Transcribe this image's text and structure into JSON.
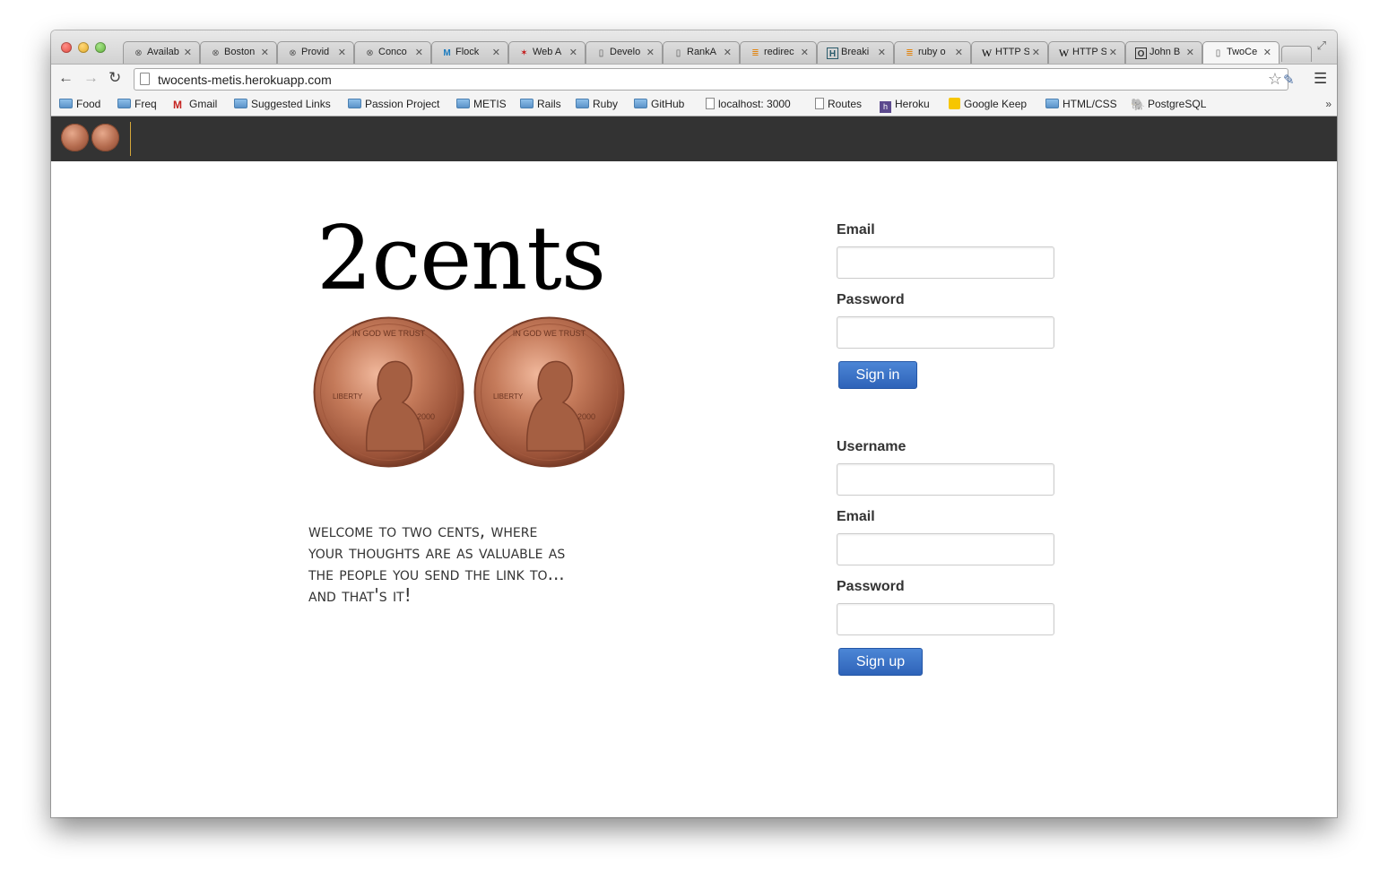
{
  "browser": {
    "tabs": [
      {
        "label": "Availab",
        "icon": "metis-icon"
      },
      {
        "label": "Boston",
        "icon": "metis-icon"
      },
      {
        "label": "Provid",
        "icon": "metis-icon"
      },
      {
        "label": "Conco",
        "icon": "metis-icon"
      },
      {
        "label": "Flock",
        "icon": "flock-icon"
      },
      {
        "label": "Web A",
        "icon": "mozilla-icon"
      },
      {
        "label": "Develo",
        "icon": "page-icon"
      },
      {
        "label": "RankA",
        "icon": "page-icon"
      },
      {
        "label": "redirec",
        "icon": "stackoverflow-icon"
      },
      {
        "label": "Breaki",
        "icon": "h-icon"
      },
      {
        "label": "ruby o",
        "icon": "stackoverflow-icon"
      },
      {
        "label": "HTTP S",
        "icon": "wikipedia-icon"
      },
      {
        "label": "HTTP S",
        "icon": "wikipedia-icon"
      },
      {
        "label": "John B",
        "icon": "o-icon"
      },
      {
        "label": "TwoCe",
        "icon": "page-icon"
      }
    ],
    "url": "twocents-metis.herokuapp.com",
    "bookmarks": [
      {
        "label": "Food",
        "icon": "folder-icon"
      },
      {
        "label": "Freq",
        "icon": "folder-icon"
      },
      {
        "label": "Gmail",
        "icon": "gmail-icon"
      },
      {
        "label": "Suggested Links",
        "icon": "folder-icon"
      },
      {
        "label": "Passion Project",
        "icon": "folder-icon"
      },
      {
        "label": "METIS",
        "icon": "folder-icon"
      },
      {
        "label": "Rails",
        "icon": "folder-icon"
      },
      {
        "label": "Ruby",
        "icon": "folder-icon"
      },
      {
        "label": "GitHub",
        "icon": "folder-icon"
      },
      {
        "label": "localhost: 3000",
        "icon": "page-icon"
      },
      {
        "label": "Routes",
        "icon": "page-icon"
      },
      {
        "label": "Heroku",
        "icon": "heroku-icon"
      },
      {
        "label": "Google Keep",
        "icon": "keep-icon"
      },
      {
        "label": "HTML/CSS",
        "icon": "folder-icon"
      },
      {
        "label": "PostgreSQL",
        "icon": "postgresql-icon"
      }
    ],
    "bookmarks_more": "»"
  },
  "hero": {
    "logo_text": "2cents",
    "welcome": "Welcome to two cents, where your thoughts are as valuable as the people you send the link to... and that's it!",
    "coin_year": "2000",
    "coin_motto": "IN GOD WE TRUST",
    "coin_liberty": "LIBERTY"
  },
  "signin": {
    "email_label": "Email",
    "password_label": "Password",
    "button": "Sign in"
  },
  "signup": {
    "username_label": "Username",
    "email_label": "Email",
    "password_label": "Password",
    "button": "Sign up"
  },
  "colors": {
    "navbar": "#333333",
    "navbar_divider": "#d4a63a",
    "button": "#2e63b9",
    "coin": "#b46b4e"
  }
}
